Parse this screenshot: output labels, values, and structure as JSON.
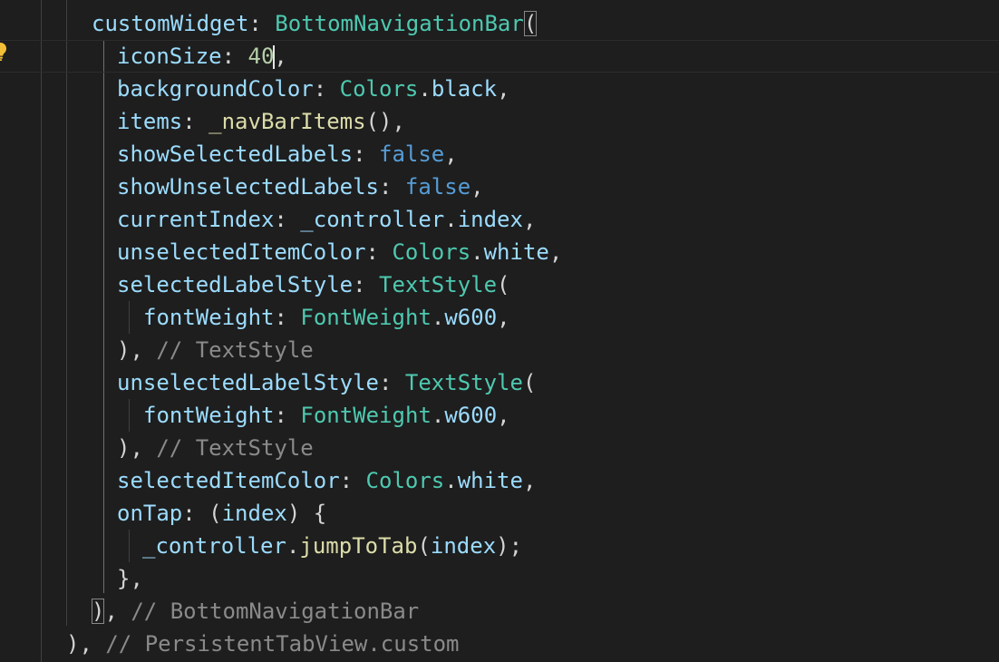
{
  "editor": {
    "colors": {
      "background": "#1e1e1e",
      "property": "#9cdcfe",
      "type": "#4ec9b0",
      "function": "#dcdcaa",
      "keyword": "#569cd6",
      "number": "#b5cea8",
      "comment": "#8a8a8a",
      "punctuation": "#d4d4d4"
    },
    "gutter_icon": "lightbulb-icon",
    "lines": [
      {
        "tokens": [
          {
            "t": "customWidget",
            "c": "prop"
          },
          {
            "t": ": ",
            "c": "pun"
          },
          {
            "t": "BottomNavigationBar",
            "c": "type"
          },
          {
            "t": "(",
            "c": "pun",
            "match": true
          }
        ]
      },
      {
        "current": true,
        "tokens": [
          {
            "t": "iconSize",
            "c": "prop"
          },
          {
            "t": ": ",
            "c": "pun"
          },
          {
            "t": "40",
            "c": "num"
          },
          {
            "cursor": true
          },
          {
            "t": ",",
            "c": "pun"
          }
        ]
      },
      {
        "tokens": [
          {
            "t": "backgroundColor",
            "c": "prop"
          },
          {
            "t": ": ",
            "c": "pun"
          },
          {
            "t": "Colors",
            "c": "type"
          },
          {
            "t": ".",
            "c": "pun"
          },
          {
            "t": "black",
            "c": "prop"
          },
          {
            "t": ",",
            "c": "pun"
          }
        ]
      },
      {
        "tokens": [
          {
            "t": "items",
            "c": "prop"
          },
          {
            "t": ": ",
            "c": "pun"
          },
          {
            "t": "_navBarItems",
            "c": "fn"
          },
          {
            "t": "(),",
            "c": "pun"
          }
        ]
      },
      {
        "tokens": [
          {
            "t": "showSelectedLabels",
            "c": "prop"
          },
          {
            "t": ": ",
            "c": "pun"
          },
          {
            "t": "false",
            "c": "kw"
          },
          {
            "t": ",",
            "c": "pun"
          }
        ]
      },
      {
        "tokens": [
          {
            "t": "showUnselectedLabels",
            "c": "prop"
          },
          {
            "t": ": ",
            "c": "pun"
          },
          {
            "t": "false",
            "c": "kw"
          },
          {
            "t": ",",
            "c": "pun"
          }
        ]
      },
      {
        "tokens": [
          {
            "t": "currentIndex",
            "c": "prop"
          },
          {
            "t": ": ",
            "c": "pun"
          },
          {
            "t": "_controller",
            "c": "prop"
          },
          {
            "t": ".",
            "c": "pun"
          },
          {
            "t": "index",
            "c": "prop"
          },
          {
            "t": ",",
            "c": "pun"
          }
        ]
      },
      {
        "tokens": [
          {
            "t": "unselectedItemColor",
            "c": "prop"
          },
          {
            "t": ": ",
            "c": "pun"
          },
          {
            "t": "Colors",
            "c": "type"
          },
          {
            "t": ".",
            "c": "pun"
          },
          {
            "t": "white",
            "c": "prop"
          },
          {
            "t": ",",
            "c": "pun"
          }
        ]
      },
      {
        "tokens": [
          {
            "t": "selectedLabelStyle",
            "c": "prop"
          },
          {
            "t": ": ",
            "c": "pun"
          },
          {
            "t": "TextStyle",
            "c": "type"
          },
          {
            "t": "(",
            "c": "pun"
          }
        ]
      },
      {
        "tokens": [
          {
            "t": "fontWeight",
            "c": "prop"
          },
          {
            "t": ": ",
            "c": "pun"
          },
          {
            "t": "FontWeight",
            "c": "type"
          },
          {
            "t": ".",
            "c": "pun"
          },
          {
            "t": "w600",
            "c": "prop"
          },
          {
            "t": ",",
            "c": "pun"
          }
        ]
      },
      {
        "tokens": [
          {
            "t": "), ",
            "c": "pun"
          },
          {
            "t": "// TextStyle",
            "c": "cmt"
          }
        ]
      },
      {
        "tokens": [
          {
            "t": "unselectedLabelStyle",
            "c": "prop"
          },
          {
            "t": ": ",
            "c": "pun"
          },
          {
            "t": "TextStyle",
            "c": "type"
          },
          {
            "t": "(",
            "c": "pun"
          }
        ]
      },
      {
        "tokens": [
          {
            "t": "fontWeight",
            "c": "prop"
          },
          {
            "t": ": ",
            "c": "pun"
          },
          {
            "t": "FontWeight",
            "c": "type"
          },
          {
            "t": ".",
            "c": "pun"
          },
          {
            "t": "w600",
            "c": "prop"
          },
          {
            "t": ",",
            "c": "pun"
          }
        ]
      },
      {
        "tokens": [
          {
            "t": "), ",
            "c": "pun"
          },
          {
            "t": "// TextStyle",
            "c": "cmt"
          }
        ]
      },
      {
        "tokens": [
          {
            "t": "selectedItemColor",
            "c": "prop"
          },
          {
            "t": ": ",
            "c": "pun"
          },
          {
            "t": "Colors",
            "c": "type"
          },
          {
            "t": ".",
            "c": "pun"
          },
          {
            "t": "white",
            "c": "prop"
          },
          {
            "t": ",",
            "c": "pun"
          }
        ]
      },
      {
        "tokens": [
          {
            "t": "onTap",
            "c": "prop"
          },
          {
            "t": ": (",
            "c": "pun"
          },
          {
            "t": "index",
            "c": "prop"
          },
          {
            "t": ") {",
            "c": "pun"
          }
        ]
      },
      {
        "tokens": [
          {
            "t": "_controller",
            "c": "prop"
          },
          {
            "t": ".",
            "c": "pun"
          },
          {
            "t": "jumpToTab",
            "c": "fn"
          },
          {
            "t": "(",
            "c": "pun"
          },
          {
            "t": "index",
            "c": "prop"
          },
          {
            "t": ");",
            "c": "pun"
          }
        ]
      },
      {
        "tokens": [
          {
            "t": "},",
            "c": "pun"
          }
        ]
      },
      {
        "tokens": [
          {
            "t": ")",
            "c": "pun",
            "match": true
          },
          {
            "t": ", ",
            "c": "pun"
          },
          {
            "t": "// BottomNavigationBar",
            "c": "cmt"
          }
        ]
      },
      {
        "tokens": [
          {
            "t": "), ",
            "c": "pun"
          },
          {
            "t": "// PersistentTabView.custom",
            "c": "cmt"
          }
        ]
      }
    ]
  }
}
